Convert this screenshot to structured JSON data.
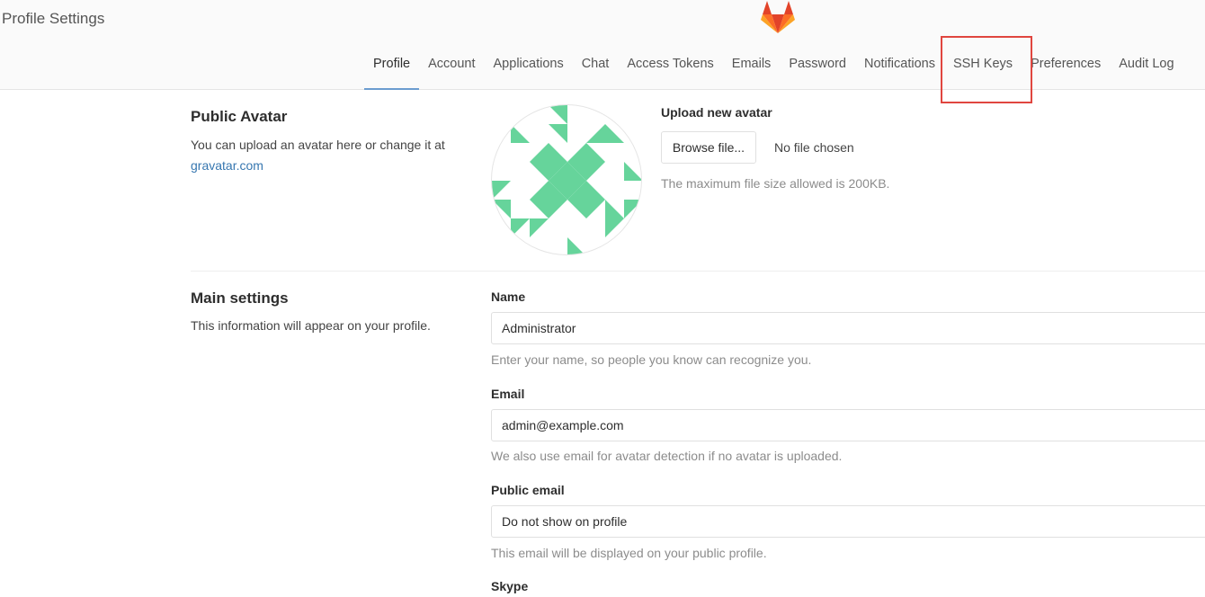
{
  "header": {
    "title": "Profile Settings",
    "logo_icon": "gitlab-tanuki-icon",
    "nav": [
      {
        "label": "Profile",
        "active": true
      },
      {
        "label": "Account"
      },
      {
        "label": "Applications"
      },
      {
        "label": "Chat"
      },
      {
        "label": "Access Tokens"
      },
      {
        "label": "Emails"
      },
      {
        "label": "Password"
      },
      {
        "label": "Notifications"
      },
      {
        "label": "SSH Keys"
      },
      {
        "label": "Preferences"
      },
      {
        "label": "Audit Log"
      }
    ]
  },
  "avatar_section": {
    "title": "Public Avatar",
    "description": "You can upload an avatar here or change it at",
    "link_text": "gravatar.com",
    "upload_label": "Upload new avatar",
    "browse_label": "Browse file...",
    "file_status": "No file chosen",
    "max_size_help": "The maximum file size allowed is 200KB."
  },
  "main_settings": {
    "title": "Main settings",
    "description": "This information will appear on your profile.",
    "name": {
      "label": "Name",
      "value": "Administrator",
      "help": "Enter your name, so people you know can recognize you."
    },
    "email": {
      "label": "Email",
      "value": "admin@example.com",
      "help": "We also use email for avatar detection if no avatar is uploaded."
    },
    "public_email": {
      "label": "Public email",
      "value": "Do not show on profile",
      "help": "This email will be displayed on your public profile."
    },
    "next_label": "Skype"
  },
  "colors": {
    "accent": "#6b9cd0",
    "highlight_box": "#e0463f",
    "identicon": "#66d49b",
    "link": "#3777b0"
  }
}
